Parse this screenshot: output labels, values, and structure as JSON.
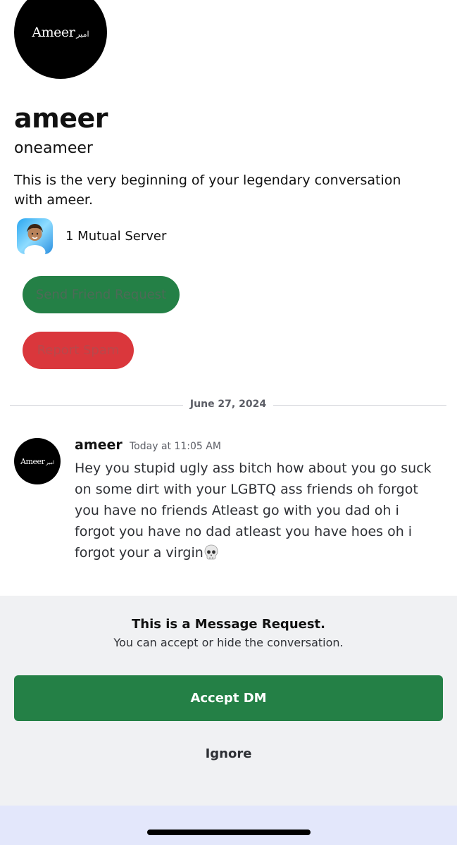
{
  "profile": {
    "logo_text": "Ameer",
    "logo_arabic": "امير",
    "display_name": "ameer",
    "username": "oneameer",
    "intro": "This is the very beginning of your legendary conversation with ameer.",
    "mutual_servers": "1 Mutual Server"
  },
  "actions": {
    "send_friend_request": "Send Friend Request",
    "report_spam": "Report Spam"
  },
  "divider": {
    "date": "June 27, 2024"
  },
  "message": {
    "author": "ameer",
    "timestamp": "Today at 11:05 AM",
    "text": "Hey you stupid ugly ass bitch how about you go suck on some dirt with your LGBTQ ass friends oh forgot you have no friends Atleast go with you dad oh i forgot you have no dad atleast you have hoes oh i forgot your a virgin",
    "emoji": "skull-emoji"
  },
  "request": {
    "title": "This is a Message Request.",
    "subtitle": "You can accept or hide the conversation.",
    "accept_label": "Accept DM",
    "ignore_label": "Ignore"
  },
  "colors": {
    "accept_green": "#248046",
    "spam_red": "#da373c",
    "panel_bg": "#f0f1f3",
    "bottom_bar": "#e3e7fb"
  }
}
